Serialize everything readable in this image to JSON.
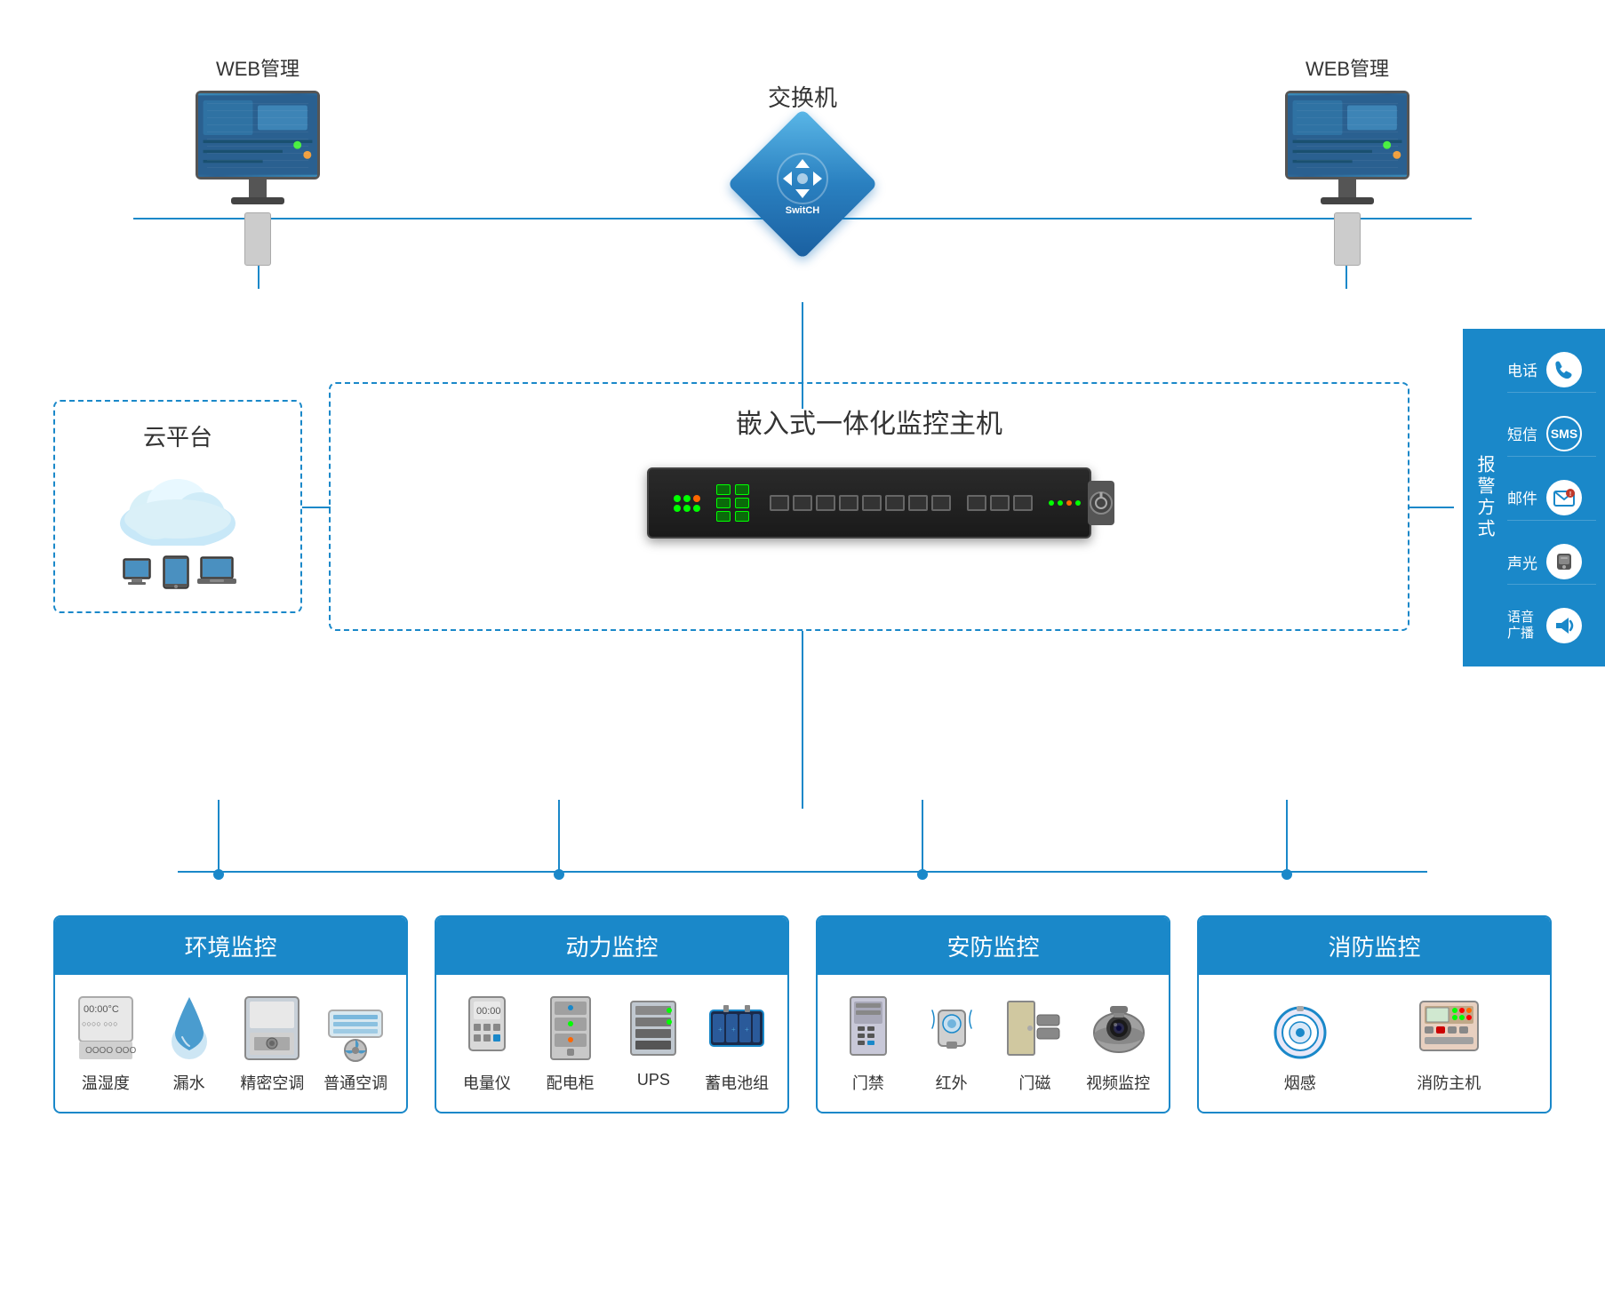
{
  "top": {
    "left_label": "WEB管理",
    "right_label": "WEB管理",
    "switch_label": "交换机",
    "switch_text": "SwitCH"
  },
  "middle": {
    "cloud_title": "云平台",
    "main_title": "嵌入式一体化监控主机",
    "alarm_label": "报警方式",
    "alarm_items": [
      {
        "label": "电话",
        "icon": "📞"
      },
      {
        "label": "短信",
        "icon": "SMS"
      },
      {
        "label": "邮件",
        "icon": "✉"
      },
      {
        "label": "声光",
        "icon": "💾"
      },
      {
        "label": "语音广播",
        "icon": "📢"
      }
    ]
  },
  "categories": [
    {
      "title": "环境监控",
      "items": [
        {
          "label": "温湿度",
          "icon": "🌡"
        },
        {
          "label": "漏水",
          "icon": "💧"
        },
        {
          "label": "精密空调",
          "icon": "🗄"
        },
        {
          "label": "普通空调",
          "icon": "🌀"
        }
      ]
    },
    {
      "title": "动力监控",
      "items": [
        {
          "label": "电量仪",
          "icon": "🔌"
        },
        {
          "label": "配电柜",
          "icon": "🗂"
        },
        {
          "label": "UPS",
          "icon": "🔋"
        },
        {
          "label": "蓄电池组",
          "icon": "🔋"
        }
      ]
    },
    {
      "title": "安防监控",
      "items": [
        {
          "label": "门禁",
          "icon": "🚪"
        },
        {
          "label": "红外",
          "icon": "📡"
        },
        {
          "label": "门磁",
          "icon": "🔒"
        },
        {
          "label": "视频监控",
          "icon": "📷"
        }
      ]
    },
    {
      "title": "消防监控",
      "items": [
        {
          "label": "烟感",
          "icon": "🔔"
        },
        {
          "label": "消防主机",
          "icon": "📋"
        }
      ]
    }
  ]
}
